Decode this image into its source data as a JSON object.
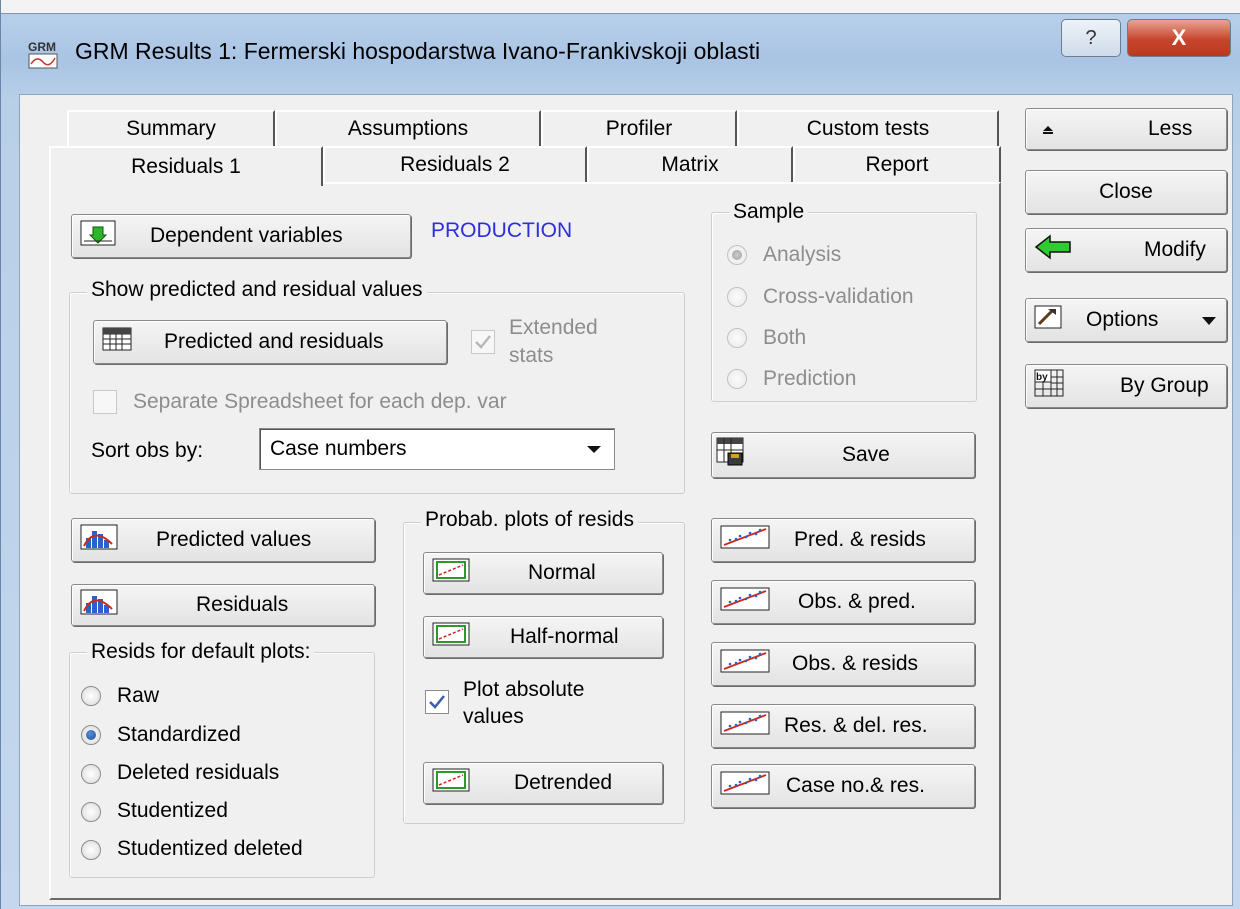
{
  "window": {
    "app_icon_label": "GRM",
    "title": "GRM Results 1: Fermerski hospodarstwa Ivano-Frankivskoji oblasti",
    "help_label": "?",
    "close_label": "X"
  },
  "tabs_row1": [
    "Summary",
    "Assumptions",
    "Profiler",
    "Custom tests"
  ],
  "tabs_row2": [
    "Residuals 1",
    "Residuals 2",
    "Matrix",
    "Report"
  ],
  "dependent": {
    "button_label": "Dependent variables",
    "value": "PRODUCTION"
  },
  "show_values": {
    "legend": "Show predicted and residual values",
    "predicted_residuals_label": "Predicted and residuals",
    "extended_stats_line1": "Extended",
    "extended_stats_line2": "stats",
    "extended_stats_checked": true,
    "separate_label": "Separate Spreadsheet for each dep. var",
    "separate_checked": false,
    "sort_label": "Sort obs by:",
    "sort_value": "Case numbers"
  },
  "sample": {
    "legend": "Sample",
    "options": [
      "Analysis",
      "Cross-validation",
      "Both",
      "Prediction"
    ],
    "selected": "Analysis"
  },
  "save_label": "Save",
  "plots_left": {
    "predicted_values_label": "Predicted values",
    "residuals_label": "Residuals"
  },
  "resids_default": {
    "legend": "Resids for default plots:",
    "options": [
      "Raw",
      "Standardized",
      "Deleted residuals",
      "Studentized",
      "Studentized deleted"
    ],
    "selected": "Standardized"
  },
  "prob_plots": {
    "legend": "Probab. plots of resids",
    "normal_label": "Normal",
    "half_normal_label": "Half-normal",
    "plot_abs_line1": "Plot absolute",
    "plot_abs_line2": "values",
    "plot_abs_checked": true,
    "detrended_label": "Detrended"
  },
  "scatter_buttons": [
    "Pred. & resids",
    "Obs. & pred.",
    "Obs. & resids",
    "Res. & del. res.",
    "Case no.& res."
  ],
  "side_buttons": {
    "less_label": "Less",
    "close_label": "Close",
    "modify_label": "Modify",
    "options_label": "Options",
    "by_group_label": "By Group"
  },
  "colors": {
    "dependent_value": "#2e2edb",
    "modify_arrow": "#2ecc2e"
  }
}
